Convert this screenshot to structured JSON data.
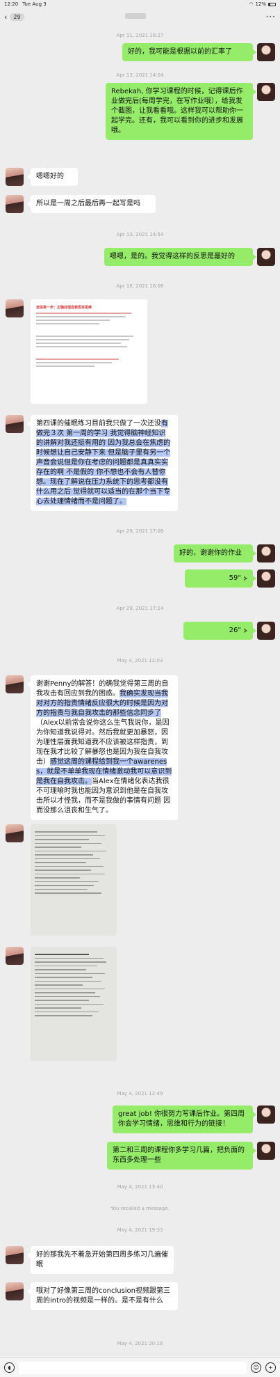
{
  "status_bar": {
    "time": "12:20",
    "date": "Tue Aug 3",
    "battery": "12%"
  },
  "nav": {
    "back_icon": "chevron-left-icon",
    "unread_count": "29",
    "more": "···"
  },
  "messages": [
    {
      "type": "timestamp",
      "text": "Apr 11, 2021 18:27"
    },
    {
      "type": "text",
      "from": "me",
      "text": "好的，我可能是根据以前的汇率了"
    },
    {
      "type": "timestamp",
      "text": "Apr 13, 2021 14:04"
    },
    {
      "type": "text",
      "from": "me",
      "text": "Rebekah, 你学习课程的时候，记得课后作业做完后(每周学完，在写作业哦），给我发个截图，让我看看哦。这样我可以帮助你一起学完。还有，我可以看到你的进步和发展哦。"
    },
    {
      "type": "text",
      "from": "you",
      "text": "嗯嗯好的"
    },
    {
      "type": "text",
      "from": "you",
      "text": "所以是一周之后最后再一起写是吗"
    },
    {
      "type": "timestamp",
      "text": "Apr 13, 2021 14:54"
    },
    {
      "type": "text",
      "from": "me",
      "text": "嗯嗯，是的。我觉得这样的反思是最好的"
    },
    {
      "type": "timestamp",
      "text": "Apr 18, 2021 16:06"
    },
    {
      "type": "image",
      "from": "you",
      "title": "自信第一步：正确处理自我否定思维"
    },
    {
      "type": "text",
      "from": "you",
      "segments": [
        {
          "t": "第四课的催眠练习目前我只做了一次还没",
          "hl": false
        },
        {
          "t": "有做完３次 第一周的学习 我觉得脑神经知识的讲解对我还挺有用的 因为我总会在焦虑的时候想让自己安静下来 但是脑子里有另一个声音会说但是你在考虑的问题都是真真实实存在的啊 不是假的 你不想也不会有人替你想。",
          "hl": true
        },
        {
          "t": "现在了解说在压力系统下的思考都没有什么用之后 觉得就可以适当的在那个当下专心去处理情绪而不是问题了。",
          "hl": true
        }
      ]
    },
    {
      "type": "timestamp",
      "text": "Apr 29, 2021 17:08"
    },
    {
      "type": "text",
      "from": "me",
      "text": "好的，谢谢你的作业"
    },
    {
      "type": "voice",
      "from": "me",
      "duration": "59\""
    },
    {
      "type": "timestamp",
      "text": "Apr 29, 2021 17:14"
    },
    {
      "type": "voice",
      "from": "me",
      "duration": "26\""
    },
    {
      "type": "timestamp",
      "text": "May 4, 2021 12:03"
    },
    {
      "type": "text",
      "from": "you",
      "segments": [
        {
          "t": "谢谢Penny的解答！的确我觉得第三周的自我攻击有回应到我的困惑。",
          "hl": false
        },
        {
          "t": "我确实发现当我对对方的指责情绪反应很大的时候是因为对方的指责与我自我攻击的那些信念同步了",
          "hl": true
        },
        {
          "t": "（Alex以前常会说你这么生气我说你，是因为你知道我说得对。然后我就更加暴怒，因为理性层面我知道我不应该被这样指责，到现在我才比较了解暴怒也是因为我在自我攻击）",
          "hl": false
        },
        {
          "t": "感觉这周的课程给到我一个awareness，就是不单单我现在情绪激动我可以意识到是我在自我攻击。",
          "hl": true
        },
        {
          "t": "当Alex在情绪化表达我很不可理喻时我也能因为意识到他是在自我攻击所以才怪我，而不是我做的事情有问题 因而没那么沮丧和生气了。",
          "hl": false
        }
      ]
    },
    {
      "type": "image",
      "from": "you",
      "title": "handwritten-notes-1"
    },
    {
      "type": "image",
      "from": "you",
      "title": "handwritten-notes-2"
    },
    {
      "type": "timestamp",
      "text": "May 4, 2021 12:49"
    },
    {
      "type": "text",
      "from": "me",
      "text": "great job! 你很努力写课后作业。第四周你会学习情绪，思维和行为的链接！"
    },
    {
      "type": "text",
      "from": "me",
      "text": "第二和三周的课程你多学习几篇，把负面的东西多处理一些"
    },
    {
      "type": "timestamp",
      "text": "May 4, 2021 13:40"
    },
    {
      "type": "recall",
      "text": "You recalled a message."
    },
    {
      "type": "timestamp",
      "text": "May 4, 2021 19:33"
    },
    {
      "type": "text",
      "from": "you",
      "text": "好的那我先不着急开始第四周多练习几遍催眠"
    },
    {
      "type": "text",
      "from": "you",
      "text": "哦对了好像第三周的conclusion视频跟第三周的intro的视频是一样的。是不是有什么"
    },
    {
      "type": "timestamp",
      "text": "May 4, 2021 20:16"
    }
  ],
  "input_bar": {
    "voice_icon": "voice-icon",
    "emoji_icon": "emoji-icon",
    "plus_icon": "plus-icon"
  }
}
